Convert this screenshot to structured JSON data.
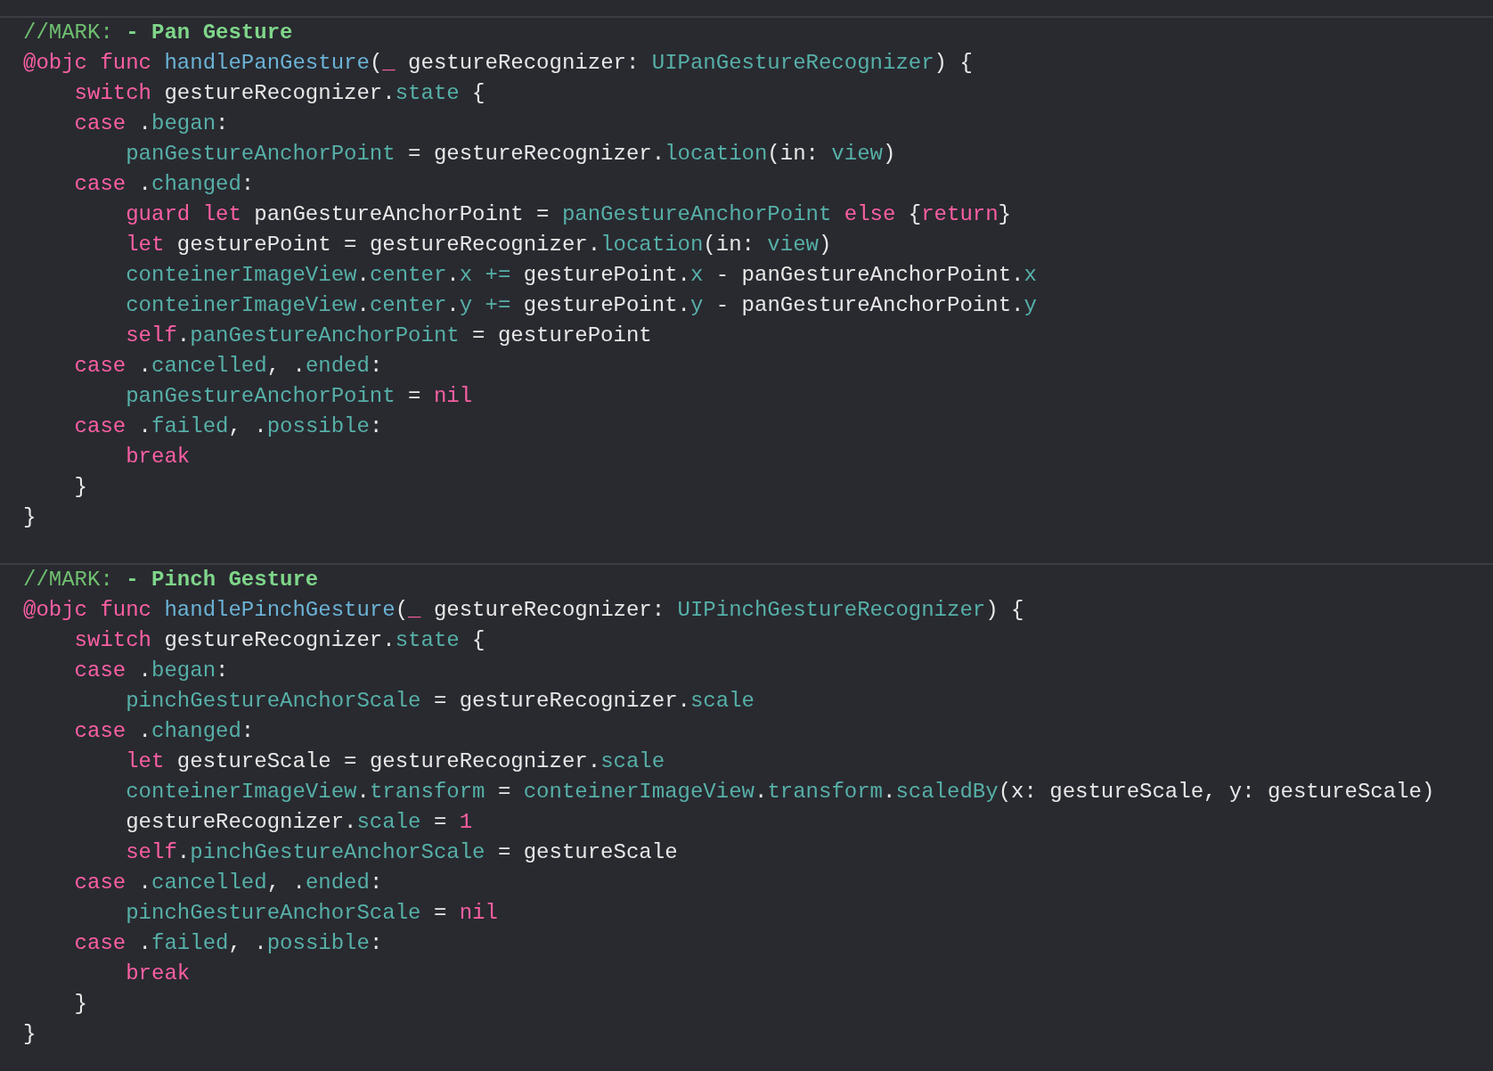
{
  "sections": [
    {
      "lines": [
        [
          {
            "kind": "cm",
            "text": "//MARK: "
          },
          {
            "kind": "mk",
            "text": "- Pan Gesture"
          }
        ],
        [
          {
            "kind": "kw",
            "text": "@objc func "
          },
          {
            "kind": "fn",
            "text": "handlePanGesture"
          },
          {
            "kind": "pl",
            "text": "("
          },
          {
            "kind": "kw",
            "text": "_"
          },
          {
            "kind": "pl",
            "text": " gestureRecognizer: "
          },
          {
            "kind": "id",
            "text": "UIPanGestureRecognizer"
          },
          {
            "kind": "pl",
            "text": ") {"
          }
        ],
        [
          {
            "kind": "kw",
            "text": "    switch"
          },
          {
            "kind": "pl",
            "text": " gestureRecognizer."
          },
          {
            "kind": "id",
            "text": "state"
          },
          {
            "kind": "pl",
            "text": " {"
          }
        ],
        [
          {
            "kind": "kw",
            "text": "    case"
          },
          {
            "kind": "pl",
            "text": " ."
          },
          {
            "kind": "id",
            "text": "began"
          },
          {
            "kind": "pl",
            "text": ":"
          }
        ],
        [
          {
            "kind": "id",
            "text": "        panGestureAnchorPoint"
          },
          {
            "kind": "pl",
            "text": " = gestureRecognizer."
          },
          {
            "kind": "id",
            "text": "location"
          },
          {
            "kind": "pl",
            "text": "(in: "
          },
          {
            "kind": "id",
            "text": "view"
          },
          {
            "kind": "pl",
            "text": ")"
          }
        ],
        [
          {
            "kind": "kw",
            "text": "    case"
          },
          {
            "kind": "pl",
            "text": " ."
          },
          {
            "kind": "id",
            "text": "changed"
          },
          {
            "kind": "pl",
            "text": ":"
          }
        ],
        [
          {
            "kind": "kw",
            "text": "        guard let"
          },
          {
            "kind": "pl",
            "text": " panGestureAnchorPoint = "
          },
          {
            "kind": "id",
            "text": "panGestureAnchorPoint"
          },
          {
            "kind": "kw",
            "text": " else"
          },
          {
            "kind": "pl",
            "text": " {"
          },
          {
            "kind": "kw",
            "text": "return"
          },
          {
            "kind": "pl",
            "text": "}"
          }
        ],
        [
          {
            "kind": "kw",
            "text": "        let"
          },
          {
            "kind": "pl",
            "text": " gesturePoint = gestureRecognizer."
          },
          {
            "kind": "id",
            "text": "location"
          },
          {
            "kind": "pl",
            "text": "(in: "
          },
          {
            "kind": "id",
            "text": "view"
          },
          {
            "kind": "pl",
            "text": ")"
          }
        ],
        [
          {
            "kind": "id",
            "text": "        conteinerImageView"
          },
          {
            "kind": "pl",
            "text": "."
          },
          {
            "kind": "id",
            "text": "center"
          },
          {
            "kind": "pl",
            "text": "."
          },
          {
            "kind": "id",
            "text": "x"
          },
          {
            "kind": "id",
            "text": " +="
          },
          {
            "kind": "pl",
            "text": " gesturePoint."
          },
          {
            "kind": "id",
            "text": "x"
          },
          {
            "kind": "pl",
            "text": " - panGestureAnchorPoint."
          },
          {
            "kind": "id",
            "text": "x"
          }
        ],
        [
          {
            "kind": "id",
            "text": "        conteinerImageView"
          },
          {
            "kind": "pl",
            "text": "."
          },
          {
            "kind": "id",
            "text": "center"
          },
          {
            "kind": "pl",
            "text": "."
          },
          {
            "kind": "id",
            "text": "y"
          },
          {
            "kind": "id",
            "text": " +="
          },
          {
            "kind": "pl",
            "text": " gesturePoint."
          },
          {
            "kind": "id",
            "text": "y"
          },
          {
            "kind": "pl",
            "text": " - panGestureAnchorPoint."
          },
          {
            "kind": "id",
            "text": "y"
          }
        ],
        [
          {
            "kind": "kw",
            "text": "        self"
          },
          {
            "kind": "pl",
            "text": "."
          },
          {
            "kind": "id",
            "text": "panGestureAnchorPoint"
          },
          {
            "kind": "pl",
            "text": " = gesturePoint"
          }
        ],
        [
          {
            "kind": "kw",
            "text": "    case"
          },
          {
            "kind": "pl",
            "text": " ."
          },
          {
            "kind": "id",
            "text": "cancelled"
          },
          {
            "kind": "pl",
            "text": ", ."
          },
          {
            "kind": "id",
            "text": "ended"
          },
          {
            "kind": "pl",
            "text": ":"
          }
        ],
        [
          {
            "kind": "id",
            "text": "        panGestureAnchorPoint"
          },
          {
            "kind": "pl",
            "text": " = "
          },
          {
            "kind": "kw",
            "text": "nil"
          }
        ],
        [
          {
            "kind": "kw",
            "text": "    case"
          },
          {
            "kind": "pl",
            "text": " ."
          },
          {
            "kind": "id",
            "text": "failed"
          },
          {
            "kind": "pl",
            "text": ", ."
          },
          {
            "kind": "id",
            "text": "possible"
          },
          {
            "kind": "pl",
            "text": ":"
          }
        ],
        [
          {
            "kind": "kw",
            "text": "        break"
          }
        ],
        [
          {
            "kind": "pl",
            "text": "    }"
          }
        ],
        [
          {
            "kind": "pl",
            "text": "}"
          }
        ]
      ]
    },
    {
      "lines": [
        [
          {
            "kind": "cm",
            "text": "//MARK: "
          },
          {
            "kind": "mk",
            "text": "- Pinch Gesture"
          }
        ],
        [
          {
            "kind": "kw",
            "text": "@objc func "
          },
          {
            "kind": "fn",
            "text": "handlePinchGesture"
          },
          {
            "kind": "pl",
            "text": "("
          },
          {
            "kind": "kw",
            "text": "_"
          },
          {
            "kind": "pl",
            "text": " gestureRecognizer: "
          },
          {
            "kind": "id",
            "text": "UIPinchGestureRecognizer"
          },
          {
            "kind": "pl",
            "text": ") {"
          }
        ],
        [
          {
            "kind": "kw",
            "text": "    switch"
          },
          {
            "kind": "pl",
            "text": " gestureRecognizer."
          },
          {
            "kind": "id",
            "text": "state"
          },
          {
            "kind": "pl",
            "text": " {"
          }
        ],
        [
          {
            "kind": "kw",
            "text": "    case"
          },
          {
            "kind": "pl",
            "text": " ."
          },
          {
            "kind": "id",
            "text": "began"
          },
          {
            "kind": "pl",
            "text": ":"
          }
        ],
        [
          {
            "kind": "id",
            "text": "        pinchGestureAnchorScale"
          },
          {
            "kind": "pl",
            "text": " = gestureRecognizer."
          },
          {
            "kind": "id",
            "text": "scale"
          }
        ],
        [
          {
            "kind": "kw",
            "text": "    case"
          },
          {
            "kind": "pl",
            "text": " ."
          },
          {
            "kind": "id",
            "text": "changed"
          },
          {
            "kind": "pl",
            "text": ":"
          }
        ],
        [
          {
            "kind": "kw",
            "text": "        let"
          },
          {
            "kind": "pl",
            "text": " gestureScale = gestureRecognizer."
          },
          {
            "kind": "id",
            "text": "scale"
          }
        ],
        [
          {
            "kind": "id",
            "text": "        conteinerImageView"
          },
          {
            "kind": "pl",
            "text": "."
          },
          {
            "kind": "id",
            "text": "transform"
          },
          {
            "kind": "pl",
            "text": " = "
          },
          {
            "kind": "id",
            "text": "conteinerImageView"
          },
          {
            "kind": "pl",
            "text": "."
          },
          {
            "kind": "id",
            "text": "transform"
          },
          {
            "kind": "pl",
            "text": "."
          },
          {
            "kind": "id",
            "text": "scaledBy"
          },
          {
            "kind": "pl",
            "text": "(x: gestureScale, y: gestureScale)"
          }
        ],
        [
          {
            "kind": "pl",
            "text": "        gestureRecognizer."
          },
          {
            "kind": "id",
            "text": "scale"
          },
          {
            "kind": "pl",
            "text": " = "
          },
          {
            "kind": "kw",
            "text": "1"
          }
        ],
        [
          {
            "kind": "kw",
            "text": "        self"
          },
          {
            "kind": "pl",
            "text": "."
          },
          {
            "kind": "id",
            "text": "pinchGestureAnchorScale"
          },
          {
            "kind": "pl",
            "text": " = gestureScale"
          }
        ],
        [
          {
            "kind": "kw",
            "text": "    case"
          },
          {
            "kind": "pl",
            "text": " ."
          },
          {
            "kind": "id",
            "text": "cancelled"
          },
          {
            "kind": "pl",
            "text": ", ."
          },
          {
            "kind": "id",
            "text": "ended"
          },
          {
            "kind": "pl",
            "text": ":"
          }
        ],
        [
          {
            "kind": "id",
            "text": "        pinchGestureAnchorScale"
          },
          {
            "kind": "pl",
            "text": " = "
          },
          {
            "kind": "kw",
            "text": "nil"
          }
        ],
        [
          {
            "kind": "kw",
            "text": "    case"
          },
          {
            "kind": "pl",
            "text": " ."
          },
          {
            "kind": "id",
            "text": "failed"
          },
          {
            "kind": "pl",
            "text": ", ."
          },
          {
            "kind": "id",
            "text": "possible"
          },
          {
            "kind": "pl",
            "text": ":"
          }
        ],
        [
          {
            "kind": "kw",
            "text": "        break"
          }
        ],
        [
          {
            "kind": "pl",
            "text": "    }"
          }
        ],
        [
          {
            "kind": "pl",
            "text": "}"
          }
        ]
      ]
    }
  ]
}
